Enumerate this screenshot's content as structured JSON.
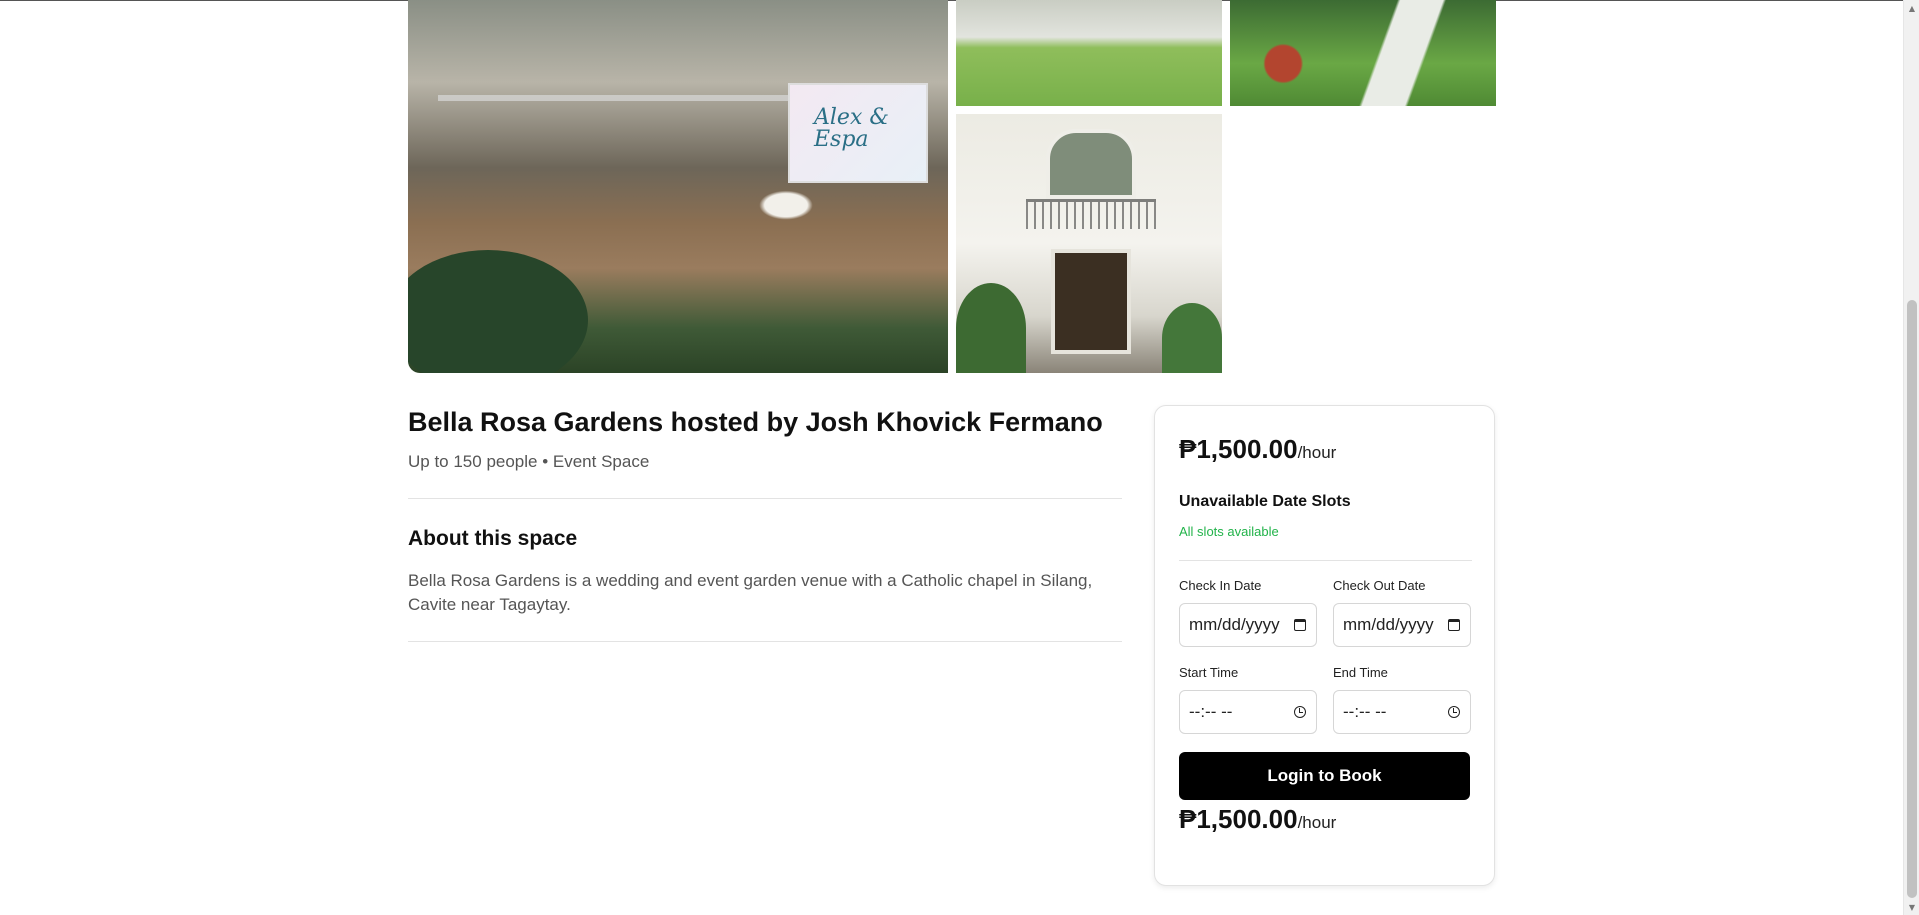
{
  "listing": {
    "title": "Bella Rosa Gardens hosted by Josh Khovick Fermano",
    "subtitle": "Up to 150 people • Event Space",
    "about_heading": "About this space",
    "about_text": "Bella Rosa Gardens is a wedding and event garden venue with a Catholic chapel in Silang, Cavite near Tagaytay.",
    "banner_text": "Alex & Espa"
  },
  "booking": {
    "price": "₱1,500.00",
    "per": "/hour",
    "unavailable_heading": "Unavailable Date Slots",
    "slots_status": "All slots available",
    "check_in_label": "Check In Date",
    "check_out_label": "Check Out Date",
    "start_time_label": "Start Time",
    "end_time_label": "End Time",
    "date_placeholder": "mm/dd/yyyy",
    "time_placeholder": "--:-- --",
    "button_label": "Login to Book",
    "footer_price": "₱1,500.00",
    "footer_per": "/hour"
  },
  "colors": {
    "accent_green": "#22b34a",
    "button_bg": "#000000"
  }
}
